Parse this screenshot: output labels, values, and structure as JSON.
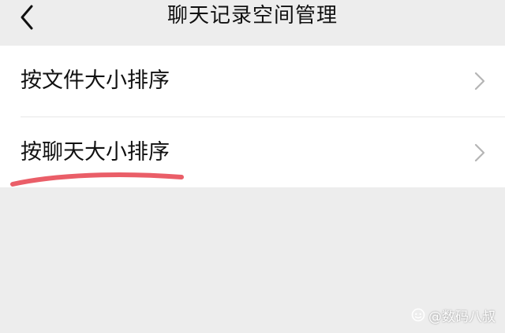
{
  "header": {
    "title": "聊天记录空间管理",
    "back_icon": "chevron-left-icon"
  },
  "list": {
    "items": [
      {
        "label": "按文件大小排序",
        "icon": "chevron-right-icon"
      },
      {
        "label": "按聊天大小排序",
        "icon": "chevron-right-icon"
      }
    ]
  },
  "annotation": {
    "color": "#e8505b"
  },
  "watermark": {
    "icon": "toutiao-logo-icon",
    "text": "@数码八叔"
  },
  "colors": {
    "background": "#ededed",
    "card": "#ffffff",
    "text": "#111111",
    "chevron": "#b5b5b5"
  }
}
